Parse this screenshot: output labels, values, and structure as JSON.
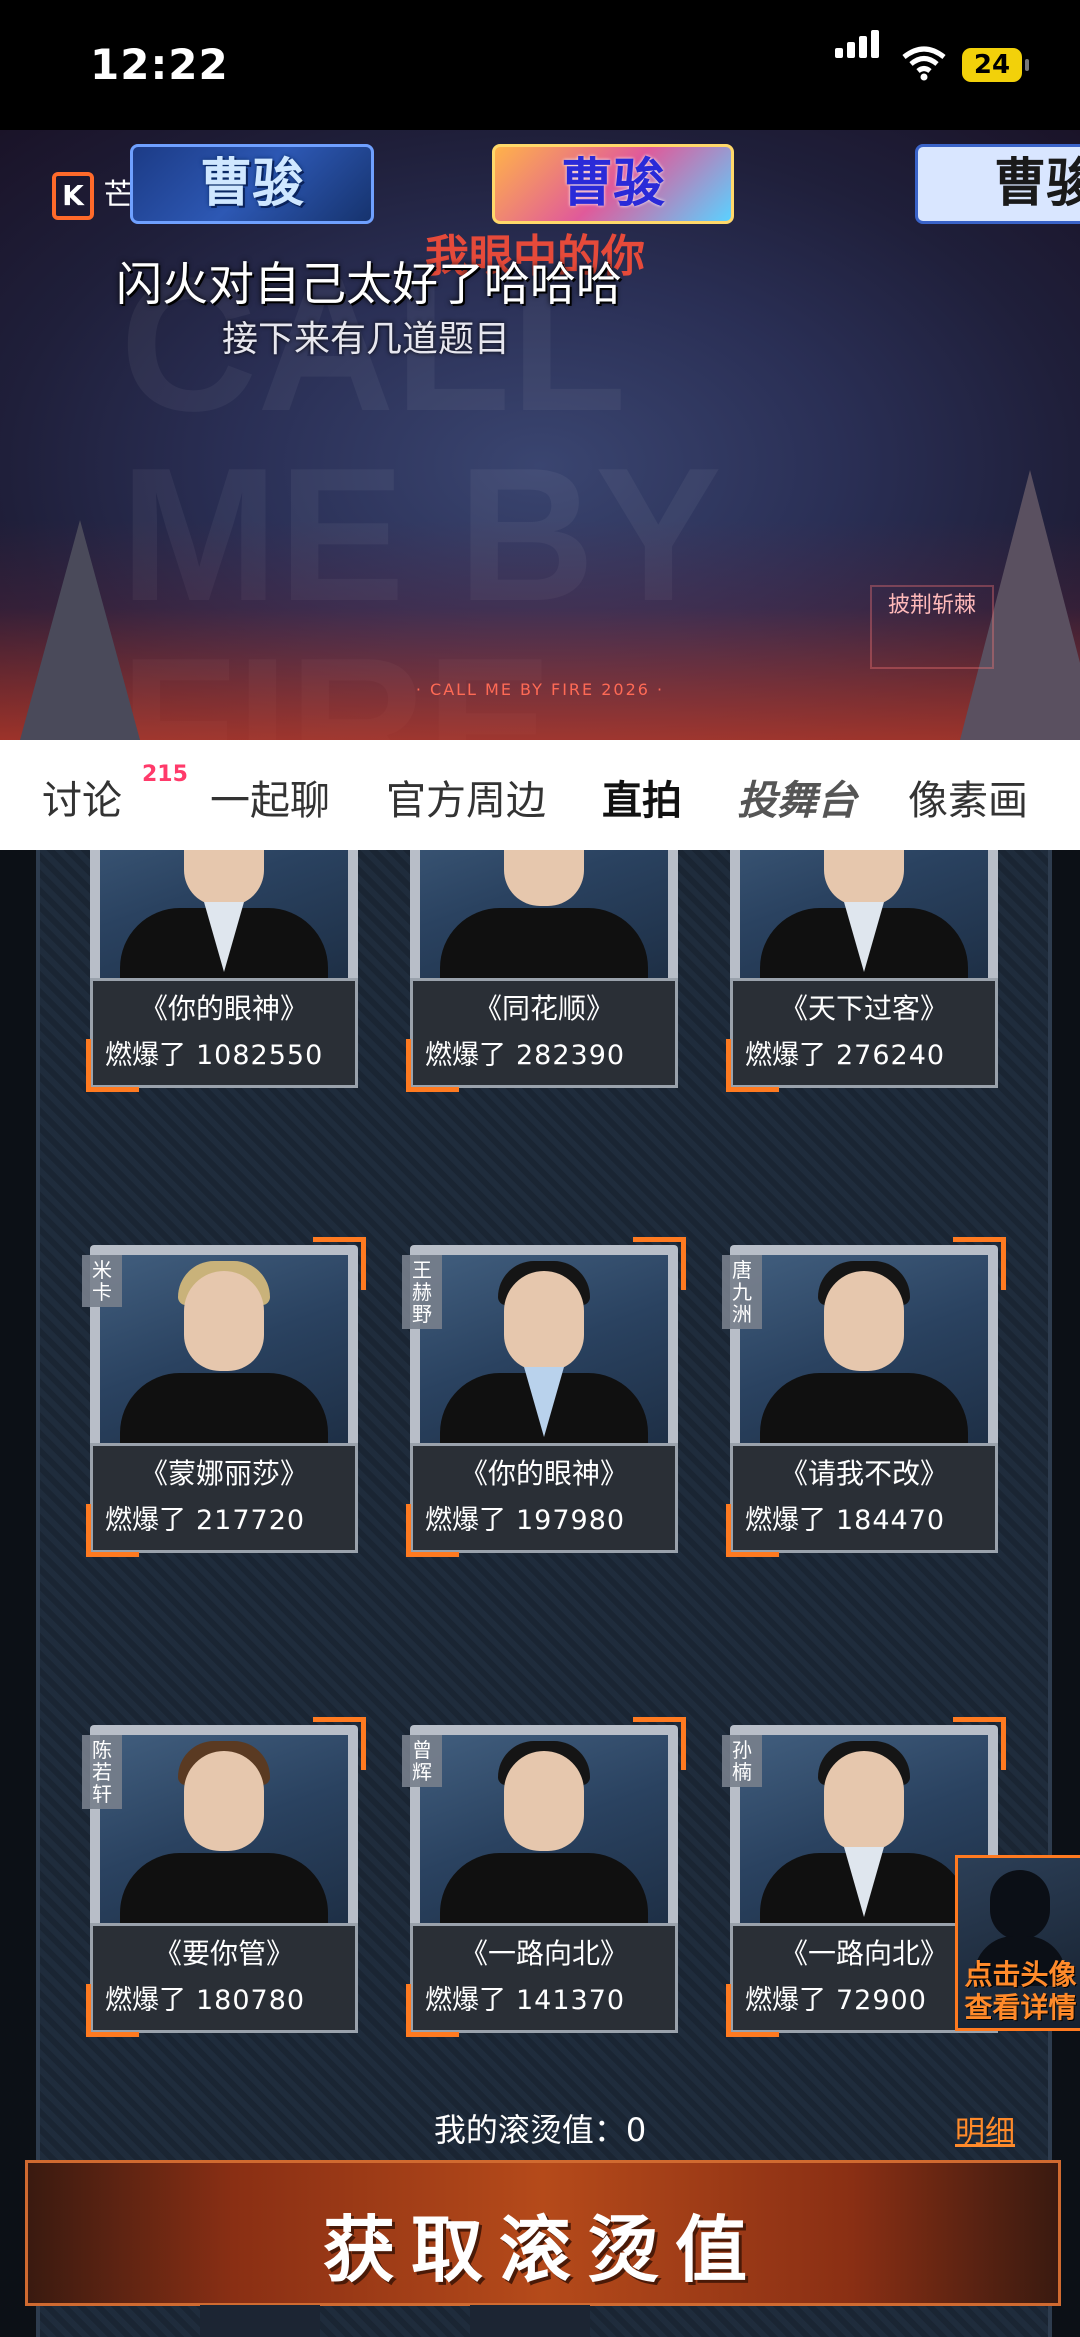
{
  "status": {
    "time": "12:22",
    "battery": "24"
  },
  "banner": {
    "logo_text": "芒",
    "pixel_names": [
      "曹骏",
      "曹骏",
      "曹骏"
    ],
    "deco_title": "我眼中的你",
    "danmu_line": "闪火对自己太好了哈哈哈",
    "subtitle": "接下来有几道题目",
    "bg_text": "CALL ME BY FIRE",
    "footer_text": "· CALL ME BY FIRE 2026 ·",
    "brand_text": "披荆斩棘"
  },
  "tabs": [
    {
      "label": "讨论",
      "badge": "215"
    },
    {
      "label": "一起聊"
    },
    {
      "label": "官方周边"
    },
    {
      "label": "直拍"
    },
    {
      "label": "投舞台"
    },
    {
      "label": "像素画"
    }
  ],
  "cards": [
    {
      "name": "",
      "song": "《你的眼神》",
      "heat_label": "燃爆了",
      "heat": "1082550"
    },
    {
      "name": "",
      "song": "《同花顺》",
      "heat_label": "燃爆了",
      "heat": "282390"
    },
    {
      "name": "",
      "song": "《天下过客》",
      "heat_label": "燃爆了",
      "heat": "276240"
    },
    {
      "name": "米卡",
      "song": "《蒙娜丽莎》",
      "heat_label": "燃爆了",
      "heat": "217720"
    },
    {
      "name": "王赫野",
      "song": "《你的眼神》",
      "heat_label": "燃爆了",
      "heat": "197980"
    },
    {
      "name": "唐九洲",
      "song": "《请我不改》",
      "heat_label": "燃爆了",
      "heat": "184470"
    },
    {
      "name": "陈若轩",
      "song": "《要你管》",
      "heat_label": "燃爆了",
      "heat": "180780"
    },
    {
      "name": "曾辉",
      "song": "《一路向北》",
      "heat_label": "燃爆了",
      "heat": "141370"
    },
    {
      "name": "孙楠",
      "song": "《一路向北》",
      "heat_label": "燃爆了",
      "heat": "72900"
    }
  ],
  "float_avatar": {
    "line1": "点击头像",
    "line2": "查看详情"
  },
  "hot_value": {
    "label": "我的滚烫值：0",
    "detail": "明细"
  },
  "cta": {
    "label": "获取滚烫值"
  }
}
